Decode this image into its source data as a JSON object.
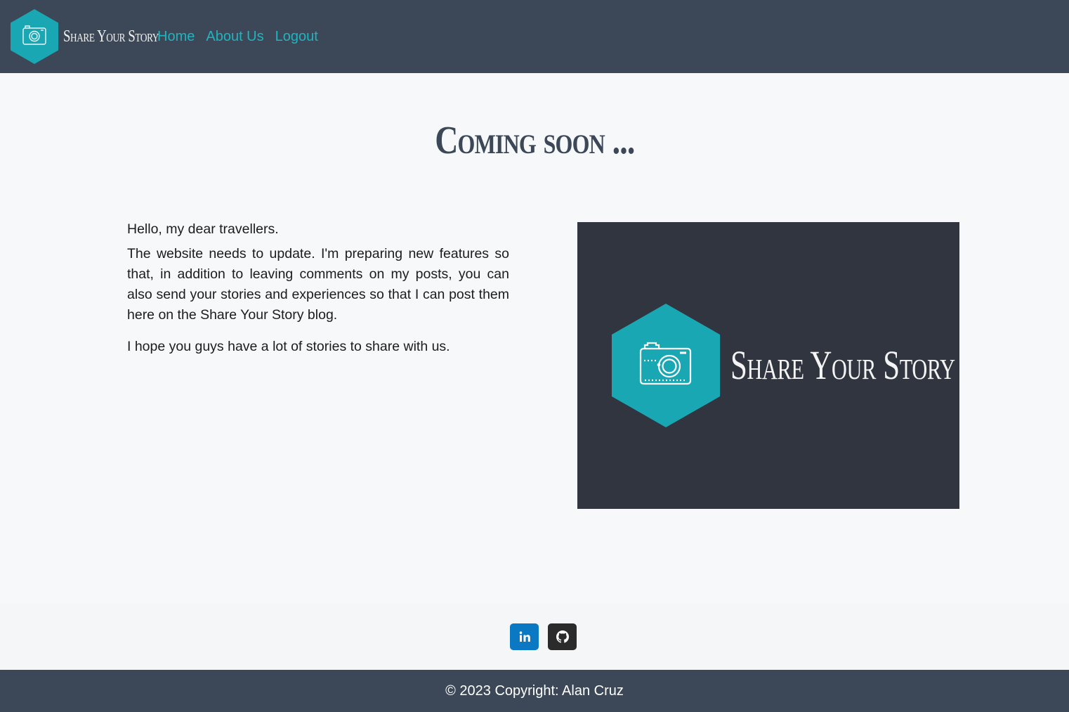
{
  "navbar": {
    "brand_name": "Share Your Story",
    "links": [
      {
        "label": "Home"
      },
      {
        "label": "About Us"
      },
      {
        "label": "Logout"
      }
    ]
  },
  "main": {
    "title": "Coming soon ...",
    "greeting": "Hello, my dear travellers.",
    "body": "The website needs to update. I'm preparing new features so that, in addition to leaving comments on my posts, you can also send your stories and experiences so that I can post them here on the Share Your Story blog.",
    "closing": "I hope you guys have a lot of stories to share with us.",
    "hero_logo_text": "Share Your Story"
  },
  "social": {
    "linkedin_icon": "linkedin-icon",
    "github_icon": "github-icon"
  },
  "footer": {
    "copyright": "© 2023 Copyright: Alan Cruz"
  },
  "colors": {
    "navbar_bg": "#3c4858",
    "accent_teal": "#1aa7b4",
    "link_color": "#20b4be",
    "hero_bg": "#30353f",
    "linkedin": "#0a78c2",
    "github": "#2b2b2b"
  }
}
